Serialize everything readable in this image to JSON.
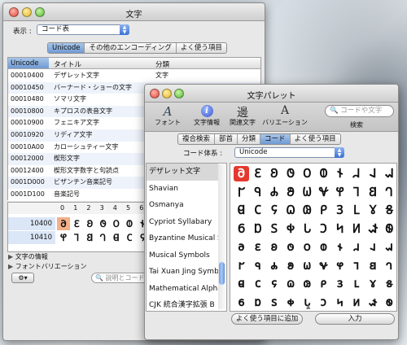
{
  "main_window": {
    "title": "文字",
    "display_label": "表示 :",
    "display_value": "コード表",
    "tabs": [
      "Unicode",
      "その他のエンコーディング",
      "よく使う項目"
    ],
    "columns": [
      "Unicode",
      "タイトル",
      "分類"
    ],
    "rows": [
      {
        "code": "00010400",
        "title": "デザレット文字",
        "category": "文字"
      },
      {
        "code": "00010450",
        "title": "バーナード・ショーの文字",
        "category": "文字"
      },
      {
        "code": "00010480",
        "title": "ソマリ文字",
        "category": "文字"
      },
      {
        "code": "00010800",
        "title": "キプロスの表音文字",
        "category": "文字"
      },
      {
        "code": "00010900",
        "title": "フェニキア文字",
        "category": "文字"
      },
      {
        "code": "00010920",
        "title": "リディア文字",
        "category": "文字"
      },
      {
        "code": "00010A00",
        "title": "カローシュティー文字",
        "category": "文字"
      },
      {
        "code": "00012000",
        "title": "楔形文字",
        "category": "文字"
      },
      {
        "code": "00012400",
        "title": "楔形文字数字と句読点",
        "category": "文字"
      },
      {
        "code": "0001D000",
        "title": "ビザンチン音楽記号",
        "category": "記号"
      },
      {
        "code": "0001D100",
        "title": "音楽記号",
        "category": "記号"
      }
    ],
    "grid_header": [
      "0",
      "1",
      "2",
      "3",
      "4",
      "5",
      "6"
    ],
    "grid_rows": [
      {
        "code": "10400",
        "glyphs": [
          "𐐀",
          "𐐁",
          "𐐂",
          "𐐃",
          "𐐄",
          "𐐅",
          "𐐆"
        ]
      },
      {
        "code": "10410",
        "glyphs": [
          "𐐐",
          "𐐑",
          "𐐒",
          "𐐓",
          "𐐔",
          "𐐕",
          "𐐖"
        ]
      }
    ],
    "info_label": "文字の情報",
    "font_variation_label": "フォントバリエーション",
    "search_placeholder": "説明とコード"
  },
  "palette": {
    "title": "文字パレット",
    "toolbar": [
      {
        "label": "フォント",
        "icon": "font-icon"
      },
      {
        "label": "文字情報",
        "icon": "info-icon"
      },
      {
        "label": "関連文字",
        "icon": "related-char-icon"
      },
      {
        "label": "バリエーション",
        "icon": "variation-icon"
      }
    ],
    "search_placeholder": "コードや文字",
    "search_label": "検索",
    "tabs": [
      "複合検索",
      "部首",
      "分類",
      "コード",
      "よく使う項目"
    ],
    "active_tab": "コード",
    "code_system_label": "コード体系 :",
    "code_system_value": "Unicode",
    "list": [
      "デザレット文字",
      "Shavian",
      "Osmanya",
      "Cypriot Syllabary",
      "Byzantine Musical Sy",
      "Musical Symbols",
      "Tai Xuan Jing Symbo",
      "Mathematical Alpha",
      "CJK 統合漢字拡張 B"
    ],
    "glyph_rows": [
      [
        "𐐀",
        "𐐁",
        "𐐂",
        "𐐃",
        "𐐄",
        "𐐅",
        "𐐆",
        "𐐇",
        "𐐈",
        "𐐉"
      ],
      [
        "𐐊",
        "𐐋",
        "𐐌",
        "𐐍",
        "𐐎",
        "𐐏",
        "𐐐",
        "𐐑",
        "𐐒",
        "𐐓"
      ],
      [
        "𐐔",
        "𐐕",
        "𐐖",
        "𐐗",
        "𐐘",
        "𐐙",
        "𐐚",
        "𐐛",
        "𐐜",
        "𐐝"
      ],
      [
        "𐐞",
        "𐐟",
        "𐐠",
        "𐐡",
        "𐐢",
        "𐐣",
        "𐐤",
        "𐐥",
        "𐐦",
        "𐐧"
      ],
      [
        "𐐨",
        "𐐩",
        "𐐪",
        "𐐫",
        "𐐬",
        "𐐭",
        "𐐮",
        "𐐯",
        "𐐰",
        "𐐱"
      ],
      [
        "𐐲",
        "𐐳",
        "𐐴",
        "𐐵",
        "𐐶",
        "𐐷",
        "𐐸",
        "𐐹",
        "𐐺",
        "𐐻"
      ],
      [
        "𐐼",
        "𐐽",
        "𐐾",
        "𐐿",
        "𐑀",
        "𐑁",
        "𐑂",
        "𐑃",
        "𐑄",
        "𐑅"
      ],
      [
        "𐑆",
        "𐑇",
        "𐑈",
        "𐑉",
        "𐑊",
        "𐑋",
        "𐑌",
        "𐑍",
        "𐑎",
        "𐑏"
      ]
    ],
    "add_favorite_button": "よく使う項目に追加",
    "insert_button": "入力"
  }
}
